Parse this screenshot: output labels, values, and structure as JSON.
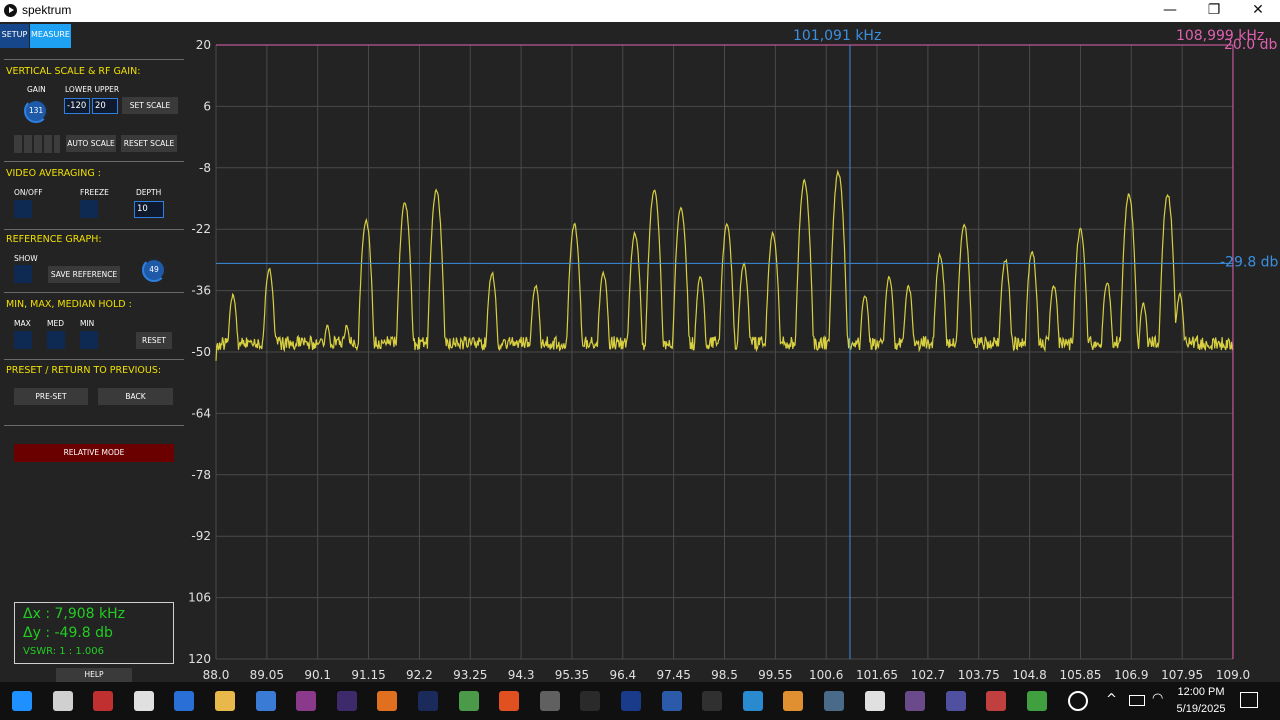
{
  "window": {
    "title": "spektrum",
    "minimize_glyph": "—",
    "restore_glyph": "❐",
    "close_glyph": "✕"
  },
  "tabs": {
    "setup": "SETUP",
    "measure": "MEASURE"
  },
  "vertical_scale": {
    "title": "VERTICAL SCALE & RF GAIN:",
    "gain_label": "GAIN",
    "gain_value": "131",
    "lower_upper_label": "LOWER UPPER",
    "lower_value": "-120",
    "upper_value": "20",
    "set_scale": "SET SCALE",
    "auto_scale": "AUTO SCALE",
    "reset_scale": "RESET SCALE"
  },
  "video_averaging": {
    "title": "VIDEO AVERAGING :",
    "on_off_label": "ON/OFF",
    "freeze_label": "FREEZE",
    "depth_label": "DEPTH",
    "depth_value": "10"
  },
  "reference_graph": {
    "title": "REFERENCE GRAPH:",
    "show_label": "SHOW",
    "save_reference": "SAVE REFERENCE",
    "knob_value": "49"
  },
  "hold": {
    "title": "MIN, MAX, MEDIAN HOLD :",
    "max_label": "MAX",
    "med_label": "MED",
    "min_label": "MIN",
    "reset": "RESET"
  },
  "preset": {
    "title": "PRESET / RETURN TO PREVIOUS:",
    "preset_button": "PRE-SET",
    "back_button": "BACK"
  },
  "relative_mode": "RELATIVE MODE",
  "readout": {
    "dx": "Δx : 7,908 kHz",
    "dy": "Δy : -49.8 db",
    "vswr": "VSWR: 1 : 1.006"
  },
  "help": "HELP",
  "colors": {
    "plot_bg": "#232323",
    "grid": "#4a4a4a",
    "trace": "#d8d040",
    "marker_blue": "#3b8fe0",
    "marker_pink": "#e060b0",
    "section_title": "#f0e000",
    "readout_green": "#22cc22"
  },
  "chart_data": {
    "type": "line",
    "title": "",
    "xlabel": "",
    "ylabel": "",
    "xlim": [
      88.0,
      109.0
    ],
    "ylim": [
      -120,
      20
    ],
    "x_ticks": [
      "88.0",
      "89.05",
      "90.1",
      "91.15",
      "92.2",
      "93.25",
      "94.3",
      "95.35",
      "96.4",
      "97.45",
      "98.5",
      "99.55",
      "100.6",
      "101.65",
      "102.7",
      "103.75",
      "104.8",
      "105.85",
      "106.9",
      "107.95",
      "109.0"
    ],
    "y_ticks": [
      "20",
      "6",
      "-8",
      "-22",
      "-36",
      "-50",
      "-64",
      "-78",
      "-92",
      "-106",
      "-120"
    ],
    "grid": true,
    "noise_floor": -48,
    "peaks": [
      {
        "x": 88.35,
        "y": -37
      },
      {
        "x": 89.1,
        "y": -31
      },
      {
        "x": 90.3,
        "y": -44
      },
      {
        "x": 90.7,
        "y": -44
      },
      {
        "x": 91.1,
        "y": -20
      },
      {
        "x": 91.9,
        "y": -16
      },
      {
        "x": 92.55,
        "y": -13
      },
      {
        "x": 93.7,
        "y": -32
      },
      {
        "x": 94.6,
        "y": -35
      },
      {
        "x": 95.4,
        "y": -21
      },
      {
        "x": 96.0,
        "y": -32
      },
      {
        "x": 96.65,
        "y": -23
      },
      {
        "x": 97.05,
        "y": -13
      },
      {
        "x": 97.6,
        "y": -17
      },
      {
        "x": 98.0,
        "y": -33
      },
      {
        "x": 98.55,
        "y": -21
      },
      {
        "x": 98.9,
        "y": -30
      },
      {
        "x": 99.5,
        "y": -23
      },
      {
        "x": 100.15,
        "y": -11
      },
      {
        "x": 100.85,
        "y": -9
      },
      {
        "x": 101.4,
        "y": -37
      },
      {
        "x": 101.9,
        "y": -33
      },
      {
        "x": 102.3,
        "y": -35
      },
      {
        "x": 102.95,
        "y": -28
      },
      {
        "x": 103.45,
        "y": -21
      },
      {
        "x": 104.3,
        "y": -29
      },
      {
        "x": 104.85,
        "y": -27
      },
      {
        "x": 105.3,
        "y": -35
      },
      {
        "x": 105.85,
        "y": -22
      },
      {
        "x": 106.4,
        "y": -34
      },
      {
        "x": 106.85,
        "y": -14
      },
      {
        "x": 107.15,
        "y": -39
      },
      {
        "x": 107.65,
        "y": -14
      },
      {
        "x": 107.9,
        "y": -37
      }
    ],
    "markers": {
      "cursor_x": 101.091,
      "cursor_x_label": "101,091 kHz",
      "cursor_y": -29.8,
      "cursor_y_label": "-29.8 db",
      "ref_x": 108.999,
      "ref_x_label": "108,999 kHz",
      "ref_y": 20.0,
      "ref_y_label": "20.0 db"
    }
  },
  "taskbar": {
    "time": "12:00 PM",
    "date": "5/19/2025",
    "icons": [
      "windows-start",
      "task-view",
      "app-dark",
      "nt-app",
      "powershell",
      "file-explorer",
      "network-app",
      "winrar",
      "audition",
      "app-orange",
      "photoshop",
      "notepad-green",
      "brave",
      "obs",
      "terminal",
      "app-blue",
      "app-blue-2",
      "app-stripes",
      "app-cross",
      "app-orange-2",
      "app-globe",
      "app-wolf",
      "winrar-2",
      "app-pen",
      "app-paint",
      "app-earth",
      "spektrum"
    ]
  }
}
